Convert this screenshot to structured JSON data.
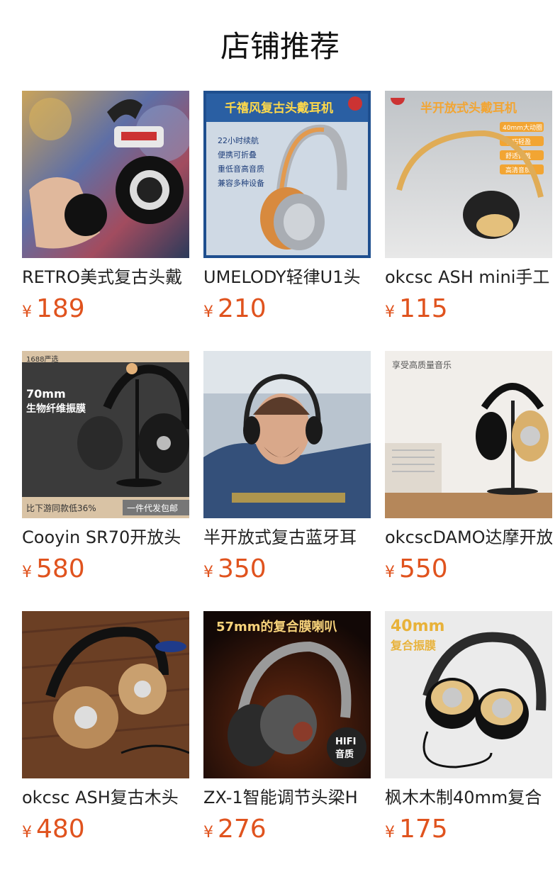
{
  "page_title": "店铺推荐",
  "currency": "¥",
  "products": [
    {
      "name": "RETRO美式复古头戴",
      "price": "189",
      "image": "retro-portable-headphone-photo",
      "image_texts": []
    },
    {
      "name": "UMELODY轻律U1头",
      "price": "210",
      "image": "silver-orange-headphone-promo",
      "image_texts": [
        "千禧风复古头戴耳机",
        "22小时续航",
        "便携可折叠",
        "重低音高音质",
        "兼容多种设备"
      ]
    },
    {
      "name": "okcsc ASH mini手工",
      "price": "115",
      "image": "wood-mini-headphone-promo",
      "image_texts": [
        "半开放式头戴耳机",
        "40mm大动圈",
        "小巧轻盈",
        "舒适佩戴",
        "高清音质"
      ]
    },
    {
      "name": "Cooyin SR70开放头",
      "price": "580",
      "image": "black-openback-headphone-stand",
      "image_texts": [
        "1688严选",
        "70mm",
        "生物纤维振膜",
        "比下游同款低36%",
        "一件代发包邮"
      ]
    },
    {
      "name": "半开放式复古蓝牙耳",
      "price": "350",
      "image": "man-wearing-headphones-photo",
      "image_texts": []
    },
    {
      "name": "okcscDAMO达摩开放",
      "price": "550",
      "image": "wood-headphone-on-stand-photo",
      "image_texts": [
        "享受高质量音乐"
      ]
    },
    {
      "name": "okcsc ASH复古木头",
      "price": "480",
      "image": "wood-headphones-on-table-photo",
      "image_texts": []
    },
    {
      "name": "ZX-1智能调节头梁H",
      "price": "276",
      "image": "headphone-fire-background-promo",
      "image_texts": [
        "57mm的复合膜喇叭",
        "HIFI",
        "音质"
      ]
    },
    {
      "name": "枫木木制40mm复合",
      "price": "175",
      "image": "maple-wood-headphone-promo",
      "image_texts": [
        "40mm",
        "复合振膜"
      ]
    }
  ],
  "colors": {
    "price": "#e0531e",
    "title": "#111111",
    "name": "#222222"
  }
}
